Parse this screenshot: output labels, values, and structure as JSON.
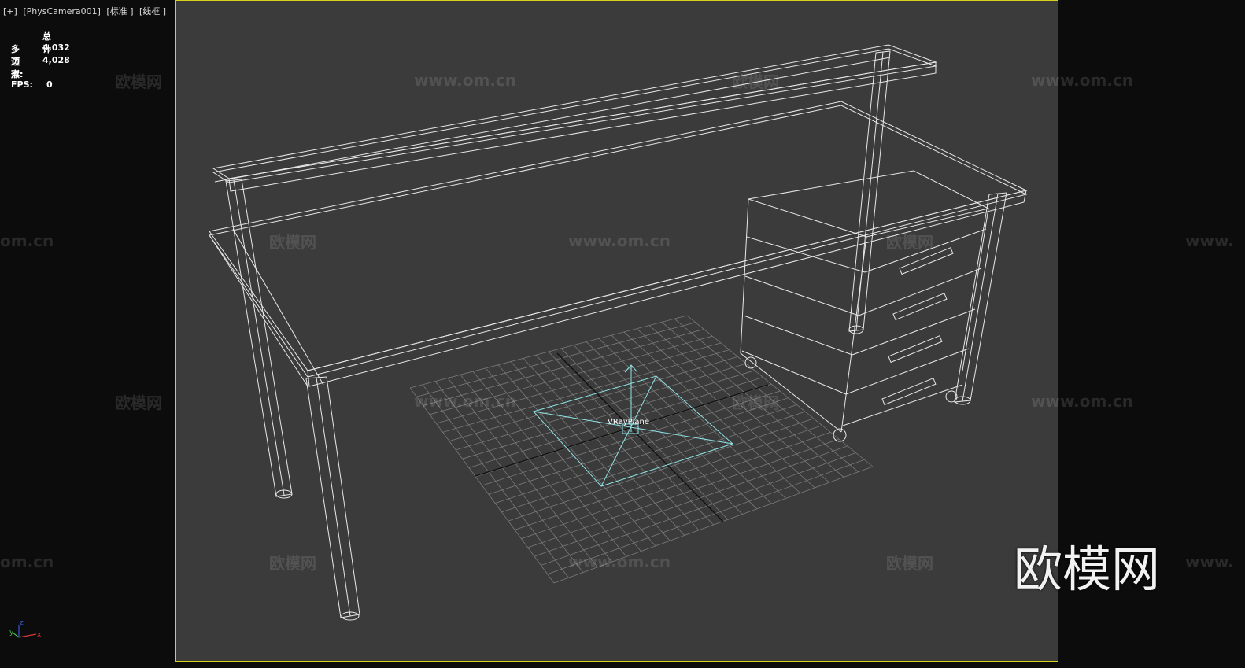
{
  "viewport": {
    "label_plus": "[+]",
    "label_camera": "[PhysCamera001]",
    "label_shading_standard": "[标准 ]",
    "label_shading_wireframe": "[线框 ]",
    "border_color": "#d7d11a",
    "background": "#3b3b3b"
  },
  "stats": {
    "total_label": "总计",
    "polygons_label": "多边形:",
    "polygons_value": "4,032",
    "vertices_label": "顶点:",
    "vertices_value": "4,028",
    "fps_label": "FPS:",
    "fps_value": "0"
  },
  "scene": {
    "object_label": "VRayPlane",
    "wire_color": "#e8e8e8",
    "vray_color": "#8fe3e6"
  },
  "gizmo": {
    "z": "z",
    "y": "y",
    "x": "x"
  },
  "watermarks": {
    "brand_cn": "欧模网",
    "brand_url": "www.om.cn",
    "brand_url_partial_left": "om.cn",
    "brand_url_partial_right": "www."
  }
}
